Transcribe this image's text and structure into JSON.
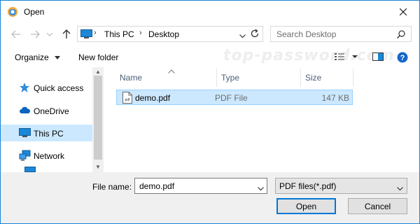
{
  "window": {
    "title": "Open"
  },
  "address_bar": {
    "breadcrumbs": [
      "This PC",
      "Desktop"
    ]
  },
  "search": {
    "placeholder": "Search Desktop"
  },
  "toolbar": {
    "organize_label": "Organize",
    "new_folder_label": "New folder"
  },
  "watermark": "top-password.com",
  "nav_pane": {
    "items": [
      {
        "label": "Quick access",
        "icon": "star-icon"
      },
      {
        "label": "OneDrive",
        "icon": "cloud-icon"
      },
      {
        "label": "This PC",
        "icon": "computer-icon",
        "selected": true
      },
      {
        "label": "Network",
        "icon": "network-icon"
      }
    ]
  },
  "file_list": {
    "columns": [
      "Name",
      "Type",
      "Size"
    ],
    "rows": [
      {
        "name": "demo.pdf",
        "type": "PDF File",
        "size": "147 KB",
        "selected": true
      }
    ]
  },
  "bottom": {
    "filename_label": "File name:",
    "filename_value": "demo.pdf",
    "filetype_value": "PDF files(*.pdf)",
    "open_label": "Open",
    "cancel_label": "Cancel"
  },
  "colors": {
    "accent": "#0078d7",
    "selection": "#cce8ff",
    "window_border": "#1883d7"
  }
}
